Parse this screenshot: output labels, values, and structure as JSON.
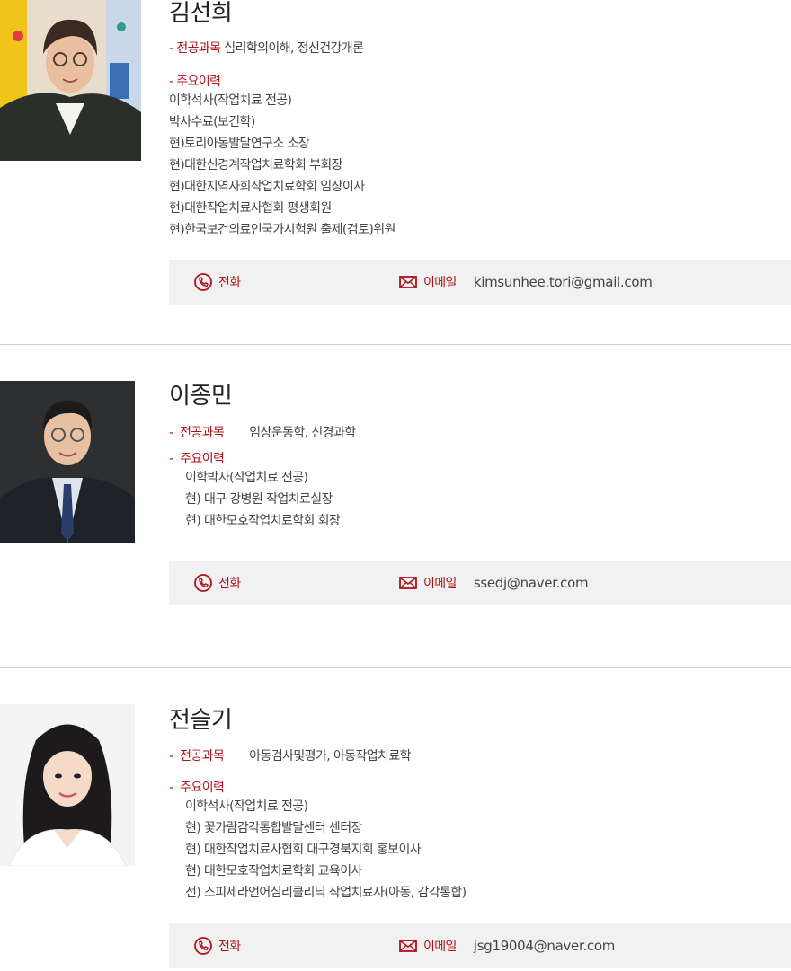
{
  "faculty": [
    {
      "name": "김선희",
      "major_label": "전공과목",
      "major_value": "심리학의이해, 정신건강개론",
      "career_label": "주요이력",
      "career": [
        "이학석사(작업치료 전공)",
        "박사수료(보건학)",
        "현)토리아동발달연구소 소장",
        "현)대한신경계작업치료학회 부회장",
        "현)대한지역사회작업치료학회 임상이사",
        "현)대한작업치료사협회 평생회원",
        "현)한국보건의료인국가시험원 출제(검토)위원"
      ],
      "phone_label": "전화",
      "email_label": "이메일",
      "email": "kimsunhee.tori@gmail.com"
    },
    {
      "name": "이종민",
      "major_label": "전공과목",
      "major_value": "임상운동학, 신경과학",
      "career_label": "주요이력",
      "career": [
        "이학박사(작업치료 전공)",
        "현) 대구 강병원 작업치료실장",
        "현) 대한모호작업치료학회 회장"
      ],
      "phone_label": "전화",
      "email_label": "이메일",
      "email": "ssedj@naver.com"
    },
    {
      "name": "전슬기",
      "major_label": "전공과목",
      "major_value": "아동검사및평가, 아동작업치료학",
      "career_label": "주요이력",
      "career": [
        "이학석사(작업치료 전공)",
        "현) 꽃가람감각통합발달센터 센터장",
        "현) 대한작업치료사협회 대구경북지회 홍보이사",
        "현) 대한모호작업치료학회 교육이사",
        "전) 스피세라언어심리클리닉 작업치료사(아동, 감각통합)"
      ],
      "phone_label": "전화",
      "email_label": "이메일",
      "email": "jsg19004@naver.com"
    }
  ],
  "colors": {
    "accent": "#b0121b",
    "contact_bg": "#f1f1f1",
    "divider": "#cccccc"
  },
  "icons": {
    "phone": "phone-icon",
    "email": "envelope-icon"
  }
}
